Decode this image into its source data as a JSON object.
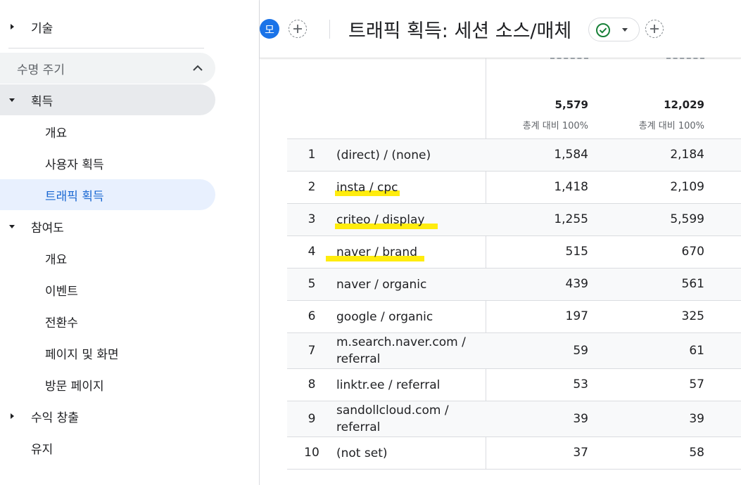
{
  "sidebar": {
    "top_item": "기술",
    "section_label": "수명 주기",
    "acquisition": {
      "label": "획득",
      "items": [
        "개요",
        "사용자 획득",
        "트래픽 획득"
      ]
    },
    "engagement": {
      "label": "참여도",
      "items": [
        "개요",
        "이벤트",
        "전환수",
        "페이지 및 화면",
        "방문 페이지"
      ]
    },
    "monetization": "수익 창출",
    "retention": "유지"
  },
  "header": {
    "avatar_letter": "모",
    "title": "트래픽 획득: 세션 소스/매체"
  },
  "table": {
    "totals": [
      {
        "value": "5,579",
        "pct": "총계 대비 100%"
      },
      {
        "value": "12,029",
        "pct": "총계 대비 100%"
      }
    ],
    "rows": [
      {
        "idx": "1",
        "src": "(direct) / (none)",
        "v1": "1,584",
        "v2": "2,184"
      },
      {
        "idx": "2",
        "src": "insta / cpc",
        "v1": "1,418",
        "v2": "2,109"
      },
      {
        "idx": "3",
        "src": "criteo / display",
        "v1": "1,255",
        "v2": "5,599"
      },
      {
        "idx": "4",
        "src": "naver / brand",
        "v1": "515",
        "v2": "670"
      },
      {
        "idx": "5",
        "src": "naver / organic",
        "v1": "439",
        "v2": "561"
      },
      {
        "idx": "6",
        "src": "google / organic",
        "v1": "197",
        "v2": "325"
      },
      {
        "idx": "7",
        "src": "m.search.naver.com / referral",
        "v1": "59",
        "v2": "61"
      },
      {
        "idx": "8",
        "src": "linktr.ee / referral",
        "v1": "53",
        "v2": "57"
      },
      {
        "idx": "9",
        "src": "sandollcloud.com / referral",
        "v1": "39",
        "v2": "39"
      },
      {
        "idx": "10",
        "src": "(not set)",
        "v1": "37",
        "v2": "58"
      }
    ]
  },
  "colors": {
    "accent": "#1a73e8",
    "highlight": "#ffeb00",
    "active_bg": "#e8f0fe",
    "status_green": "#188038"
  }
}
